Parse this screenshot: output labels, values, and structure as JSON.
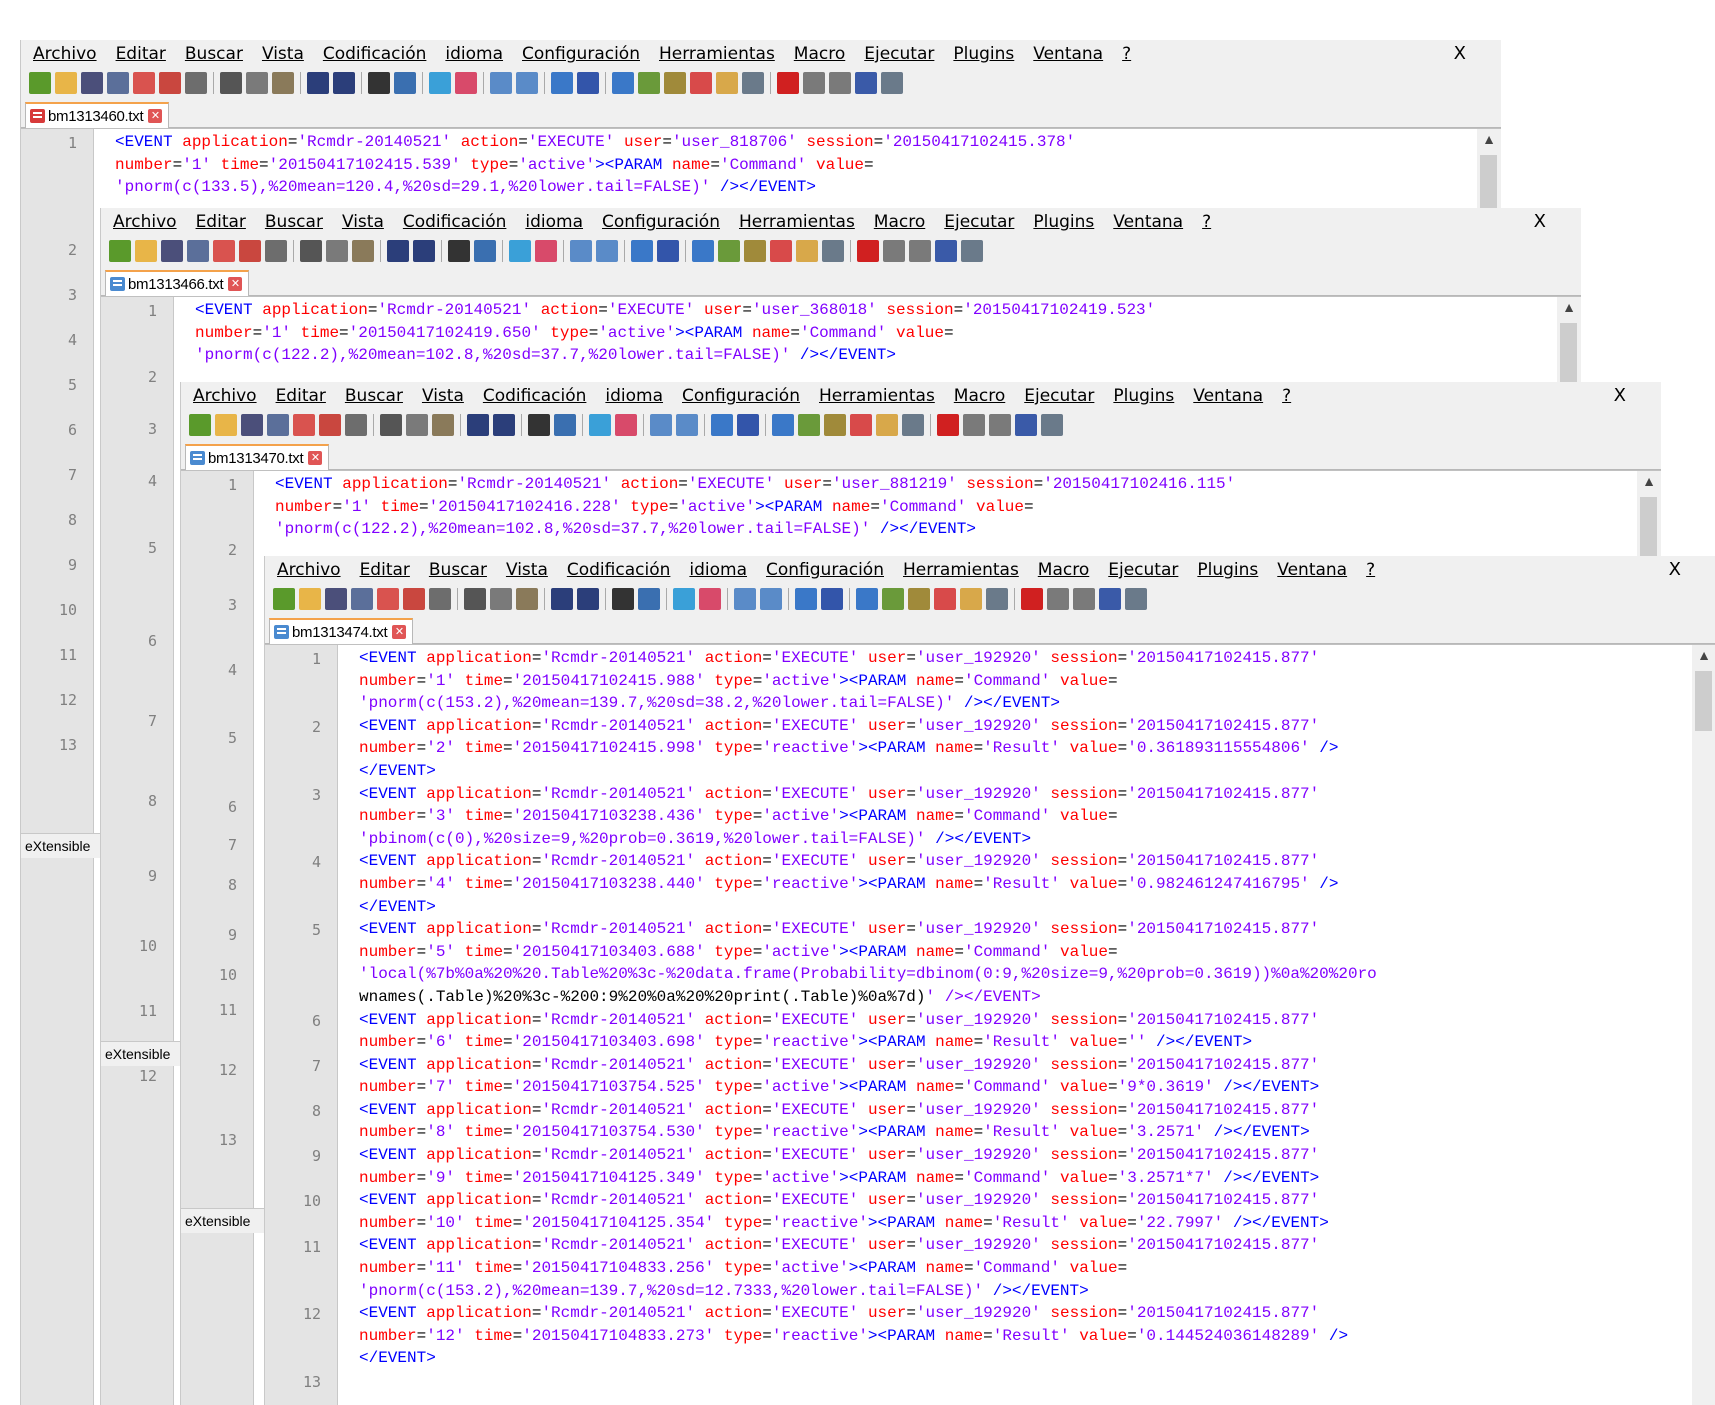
{
  "menu": [
    "Archivo",
    "Editar",
    "Buscar",
    "Vista",
    "Codificación",
    "idioma",
    "Configuración",
    "Herramientas",
    "Macro",
    "Ejecutar",
    "Plugins",
    "Ventana",
    "?"
  ],
  "close_glyph": "X",
  "tab_close_glyph": "✕",
  "scroll_up_glyph": "▲",
  "status_text": "eXtensible",
  "toolbar_icons": [
    {
      "name": "new-file-icon",
      "color": "#5a9a2b"
    },
    {
      "name": "open-file-icon",
      "color": "#e8b548"
    },
    {
      "name": "save-icon",
      "color": "#4b4f7a"
    },
    {
      "name": "save-all-icon",
      "color": "#5b6f9a"
    },
    {
      "name": "close-icon",
      "color": "#d9534f"
    },
    {
      "name": "close-all-icon",
      "color": "#c9473f"
    },
    {
      "name": "print-icon",
      "color": "#6d6d6d"
    },
    {
      "sep": true
    },
    {
      "name": "cut-icon",
      "color": "#555555"
    },
    {
      "name": "copy-icon",
      "color": "#7a7a7a"
    },
    {
      "name": "paste-icon",
      "color": "#8a7a5a"
    },
    {
      "sep": true
    },
    {
      "name": "undo-icon",
      "color": "#2b3e7a"
    },
    {
      "name": "redo-icon",
      "color": "#2b3e7a"
    },
    {
      "sep": true
    },
    {
      "name": "find-icon",
      "color": "#333333"
    },
    {
      "name": "replace-icon",
      "color": "#3a6fb0"
    },
    {
      "sep": true
    },
    {
      "name": "zoom-in-icon",
      "color": "#3aa0d8"
    },
    {
      "name": "zoom-out-icon",
      "color": "#d84a6a"
    },
    {
      "sep": true
    },
    {
      "name": "sync-vertical-icon",
      "color": "#5a8bc8"
    },
    {
      "name": "sync-horizontal-icon",
      "color": "#5a8bc8"
    },
    {
      "sep": true
    },
    {
      "name": "word-wrap-icon",
      "color": "#3a78c8"
    },
    {
      "name": "show-all-chars-icon",
      "color": "#3355aa"
    },
    {
      "sep": true
    },
    {
      "name": "indent-guide-icon",
      "color": "#3a78c8"
    },
    {
      "name": "user-language-icon",
      "color": "#6a9a3a"
    },
    {
      "name": "doc-map-icon",
      "color": "#a08a3a"
    },
    {
      "name": "function-list-icon",
      "color": "#d84a4a"
    },
    {
      "name": "folder-workspace-icon",
      "color": "#d8a84a"
    },
    {
      "name": "monitoring-icon",
      "color": "#6a7a8a"
    },
    {
      "sep": true
    },
    {
      "name": "record-macro-icon",
      "color": "#d02020"
    },
    {
      "name": "stop-macro-icon",
      "color": "#7a7a7a"
    },
    {
      "name": "play-macro-icon",
      "color": "#7a7a7a"
    },
    {
      "name": "run-macro-multiple-icon",
      "color": "#3a5aa8"
    },
    {
      "name": "save-macro-icon",
      "color": "#6a7a8a"
    }
  ],
  "windows": [
    {
      "tab_label": "bm1313460.txt",
      "tab_icon": "red",
      "line_numbers": [
        "1",
        "2",
        "3",
        "4",
        "5",
        "6",
        "7",
        "8",
        "9",
        "10",
        "11",
        "12",
        "13"
      ],
      "lines": [
        "<EVENT application='Rcmdr-20140521' action='EXECUTE' user='user_818706' session='20150417102415.378'",
        "number='1' time='20150417102415.539' type='active'><PARAM name='Command' value=",
        "'pnorm(c(133.5),%20mean=120.4,%20sd=29.1,%20lower.tail=FALSE)' /></EVENT>"
      ]
    },
    {
      "tab_label": "bm1313466.txt",
      "tab_icon": "blue",
      "line_numbers": [
        "1",
        "2",
        "3",
        "4",
        "5",
        "6",
        "7",
        "8",
        "9",
        "10",
        "11",
        "12"
      ],
      "lines": [
        "<EVENT application='Rcmdr-20140521' action='EXECUTE' user='user_368018' session='20150417102419.523'",
        "number='1' time='20150417102419.650' type='active'><PARAM name='Command' value=",
        "'pnorm(c(122.2),%20mean=102.8,%20sd=37.7,%20lower.tail=FALSE)' /></EVENT>"
      ]
    },
    {
      "tab_label": "bm1313470.txt",
      "tab_icon": "blue",
      "line_numbers": [
        "1",
        "2",
        "3",
        "4",
        "5",
        "6",
        "7",
        "8",
        "9",
        "10",
        "11",
        "12",
        "13"
      ],
      "lines": [
        "<EVENT application='Rcmdr-20140521' action='EXECUTE' user='user_881219' session='20150417102416.115'",
        "number='1' time='20150417102416.228' type='active'><PARAM name='Command' value=",
        "'pnorm(c(122.2),%20mean=102.8,%20sd=37.7,%20lower.tail=FALSE)' /></EVENT>"
      ]
    },
    {
      "tab_label": "bm1313474.txt",
      "tab_icon": "blue",
      "line_numbers": [
        "1",
        "2",
        "3",
        "4",
        "5",
        "6",
        "7",
        "8",
        "9",
        "10",
        "11",
        "12",
        "13"
      ],
      "lines": [
        "<EVENT application='Rcmdr-20140521' action='EXECUTE' user='user_192920' session='20150417102415.877'",
        "number='1' time='20150417102415.988' type='active'><PARAM name='Command' value=",
        "'pnorm(c(153.2),%20mean=139.7,%20sd=38.2,%20lower.tail=FALSE)' /></EVENT>",
        "<EVENT application='Rcmdr-20140521' action='EXECUTE' user='user_192920' session='20150417102415.877'",
        "number='2' time='20150417102415.998' type='reactive'><PARAM name='Result' value='0.361893115554806' />",
        "</EVENT>",
        "<EVENT application='Rcmdr-20140521' action='EXECUTE' user='user_192920' session='20150417102415.877'",
        "number='3' time='20150417103238.436' type='active'><PARAM name='Command' value=",
        "'pbinom(c(0),%20size=9,%20prob=0.3619,%20lower.tail=FALSE)' /></EVENT>",
        "<EVENT application='Rcmdr-20140521' action='EXECUTE' user='user_192920' session='20150417102415.877'",
        "number='4' time='20150417103238.440' type='reactive'><PARAM name='Result' value='0.982461247416795' />",
        "</EVENT>",
        "<EVENT application='Rcmdr-20140521' action='EXECUTE' user='user_192920' session='20150417102415.877'",
        "number='5' time='20150417103403.688' type='active'><PARAM name='Command' value=",
        "'local(%7b%0a%20%20.Table%20%3c-%20data.frame(Probability=dbinom(0:9,%20size=9,%20prob=0.3619))%0a%20%20ro",
        "wnames(.Table)%20%3c-%200:9%20%0a%20%20print(.Table)%0a%7d)' /></EVENT>",
        "<EVENT application='Rcmdr-20140521' action='EXECUTE' user='user_192920' session='20150417102415.877'",
        "number='6' time='20150417103403.698' type='reactive'><PARAM name='Result' value='' /></EVENT>",
        "<EVENT application='Rcmdr-20140521' action='EXECUTE' user='user_192920' session='20150417102415.877'",
        "number='7' time='20150417103754.525' type='active'><PARAM name='Command' value='9*0.3619' /></EVENT>",
        "<EVENT application='Rcmdr-20140521' action='EXECUTE' user='user_192920' session='20150417102415.877'",
        "number='8' time='20150417103754.530' type='reactive'><PARAM name='Result' value='3.2571' /></EVENT>",
        "<EVENT application='Rcmdr-20140521' action='EXECUTE' user='user_192920' session='20150417102415.877'",
        "number='9' time='20150417104125.349' type='active'><PARAM name='Command' value='3.2571*7' /></EVENT>",
        "<EVENT application='Rcmdr-20140521' action='EXECUTE' user='user_192920' session='20150417102415.877'",
        "number='10' time='20150417104125.354' type='reactive'><PARAM name='Result' value='22.7997' /></EVENT>",
        "<EVENT application='Rcmdr-20140521' action='EXECUTE' user='user_192920' session='20150417102415.877'",
        "number='11' time='20150417104833.256' type='active'><PARAM name='Command' value=",
        "'pnorm(c(153.2),%20mean=139.7,%20sd=12.7333,%20lower.tail=FALSE)' /></EVENT>",
        "<EVENT application='Rcmdr-20140521' action='EXECUTE' user='user_192920' session='20150417102415.877'",
        "number='12' time='20150417104833.273' type='reactive'><PARAM name='Result' value='0.144524036148289' />",
        "</EVENT>"
      ]
    }
  ]
}
